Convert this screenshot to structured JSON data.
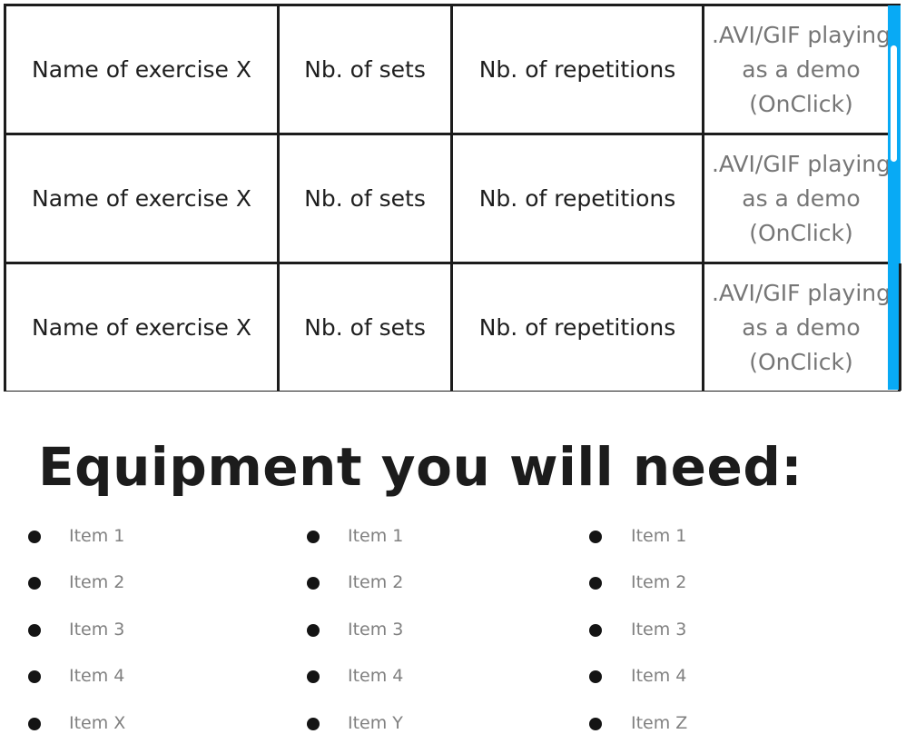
{
  "exercises": [
    {
      "name": "Name of exercise X",
      "sets": "Nb. of sets",
      "reps": "Nb. of repetitions",
      "demo": [
        ".AVI/GIF playing",
        "as a demo",
        "(OnClick)"
      ]
    },
    {
      "name": "Name of exercise X",
      "sets": "Nb. of sets",
      "reps": "Nb. of repetitions",
      "demo": [
        ".AVI/GIF playing",
        "as a demo",
        "(OnClick)"
      ]
    },
    {
      "name": "Name of exercise X",
      "sets": "Nb. of sets",
      "reps": "Nb. of repetitions",
      "demo": [
        ".AVI/GIF playing",
        "as a demo",
        "(OnClick)"
      ]
    }
  ],
  "scrollbar": {
    "track_color": "#08aaf5",
    "thumb_color": "#ffffff"
  },
  "equipment": {
    "title": "Equipment you will need:",
    "columns": [
      [
        "Item 1",
        "Item 2",
        "Item 3",
        "Item 4",
        "Item X"
      ],
      [
        "Item 1",
        "Item 2",
        "Item 3",
        "Item 4",
        "Item Y"
      ],
      [
        "Item 1",
        "Item 2",
        "Item 3",
        "Item 4",
        "Item Z"
      ]
    ]
  }
}
